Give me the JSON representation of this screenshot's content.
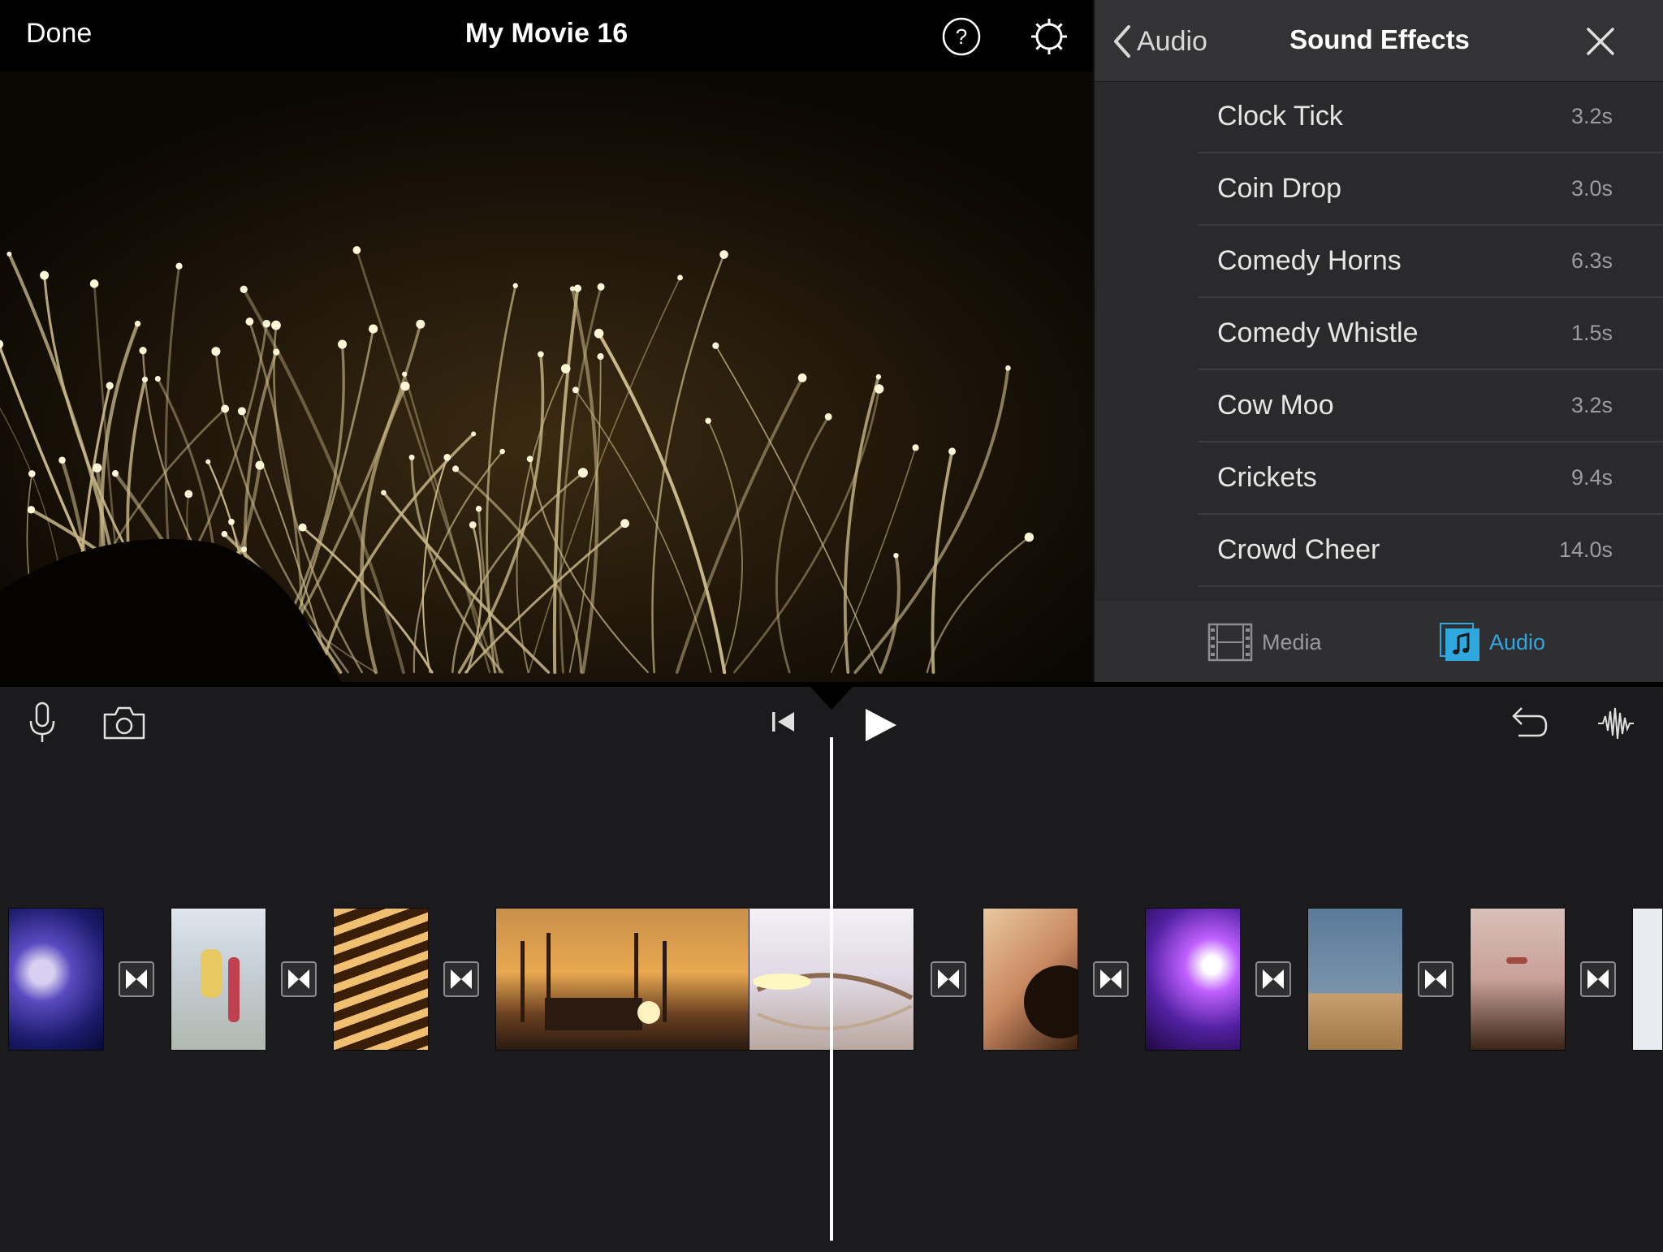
{
  "topbar": {
    "done_label": "Done",
    "title": "My Movie 16"
  },
  "panel": {
    "back_label": "Audio",
    "title": "Sound Effects",
    "effects": [
      {
        "name": "Clock Tick",
        "duration": "3.2s"
      },
      {
        "name": "Coin Drop",
        "duration": "3.0s"
      },
      {
        "name": "Comedy Horns",
        "duration": "6.3s"
      },
      {
        "name": "Comedy Whistle",
        "duration": "1.5s"
      },
      {
        "name": "Cow Moo",
        "duration": "3.2s"
      },
      {
        "name": "Crickets",
        "duration": "9.4s"
      },
      {
        "name": "Crowd Cheer",
        "duration": "14.0s"
      }
    ],
    "tabs": {
      "media_label": "Media",
      "audio_label": "Audio"
    }
  },
  "colors": {
    "accent": "#2fa8e0",
    "panel_bg": "#2a2a2c",
    "timeline_bg": "#1b1b1d"
  },
  "icons": [
    "help-icon",
    "settings-gear-icon",
    "chevron-left-icon",
    "close-icon",
    "film-icon",
    "music-note-icon",
    "microphone-icon",
    "camera-icon",
    "skip-to-start-icon",
    "play-icon",
    "undo-icon",
    "waveform-icon",
    "transition-icon"
  ]
}
